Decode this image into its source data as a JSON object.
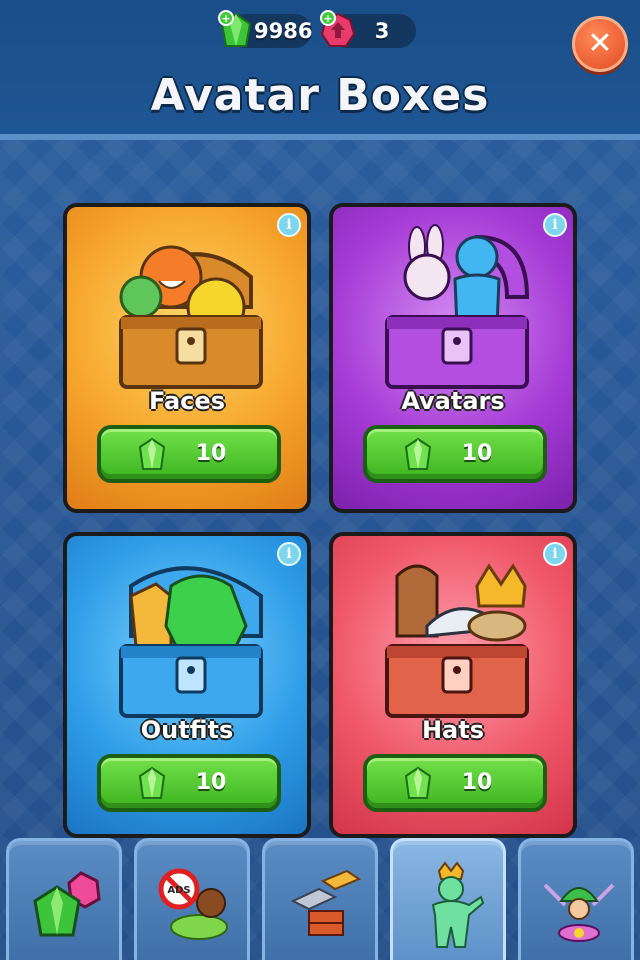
{
  "header": {
    "title": "Avatar Boxes",
    "gems_count": "9986",
    "tokens_count": "3",
    "close_icon": "close-icon"
  },
  "boxes": [
    {
      "label": "Faces",
      "price": "10",
      "color": "#f6a52b",
      "icon": "faces-chest-icon"
    },
    {
      "label": "Avatars",
      "price": "10",
      "color": "#a63bd6",
      "icon": "avatars-chest-icon"
    },
    {
      "label": "Outfits",
      "price": "10",
      "color": "#2f9ee8",
      "icon": "outfits-chest-icon"
    },
    {
      "label": "Hats",
      "price": "10",
      "color": "#f05869",
      "icon": "hats-chest-icon"
    }
  ],
  "tabs": [
    {
      "icon": "gems-shop-icon"
    },
    {
      "icon": "no-ads-icon"
    },
    {
      "icon": "building-blocks-icon"
    },
    {
      "icon": "avatar-icon",
      "active": true
    },
    {
      "icon": "gear-bundle-icon"
    }
  ],
  "colors": {
    "accent_green": "#3cb51f",
    "header_bg": "#1a4e88",
    "close_orange": "#e24a22"
  }
}
